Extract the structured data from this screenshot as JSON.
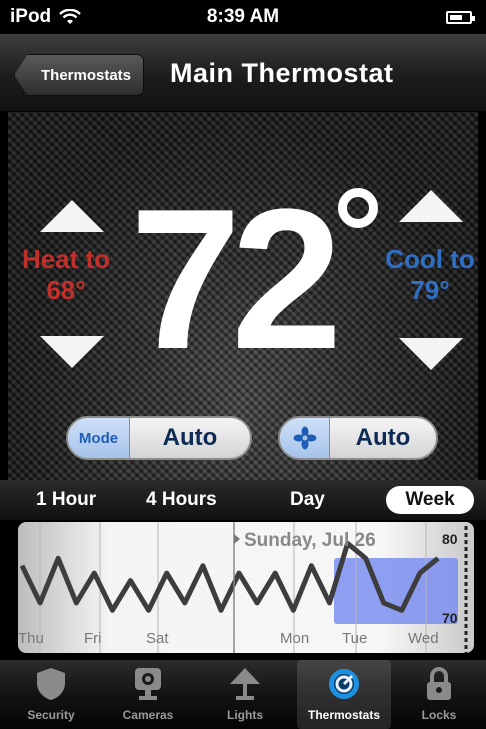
{
  "status_bar": {
    "carrier": "iPod",
    "time": "8:39 AM"
  },
  "nav": {
    "back_label": "Thermostats",
    "title": "Main Thermostat"
  },
  "thermostat": {
    "current_temp": "72",
    "heat_label": "Heat to",
    "heat_setpoint": "68°",
    "cool_label": "Cool to",
    "cool_setpoint": "79°",
    "mode_label": "Mode",
    "mode_value": "Auto",
    "fan_value": "Auto"
  },
  "range_tabs": {
    "one_hour": "1 Hour",
    "four_hours": "4 Hours",
    "day": "Day",
    "week": "Week",
    "selected": "Week"
  },
  "chart_data": {
    "type": "line",
    "title": "Sunday, Jul 26",
    "x_tick_labels": [
      "Thu",
      "Fri",
      "Sat",
      "Mon",
      "Tue",
      "Wed"
    ],
    "y_tick_labels": [
      "80",
      "70"
    ],
    "ylim": [
      67,
      81
    ],
    "series": [
      {
        "values": [
          77,
          72,
          78,
          72,
          76,
          71,
          75,
          71,
          76,
          72,
          77,
          71,
          76,
          72,
          76,
          71,
          77,
          72,
          80,
          78,
          72,
          71,
          76,
          78
        ]
      }
    ]
  },
  "tabbar": {
    "items": [
      {
        "label": "Security",
        "icon": "shield-icon"
      },
      {
        "label": "Cameras",
        "icon": "camera-icon"
      },
      {
        "label": "Lights",
        "icon": "lamp-icon"
      },
      {
        "label": "Thermostats",
        "icon": "thermostat-dial-icon"
      },
      {
        "label": "Locks",
        "icon": "lock-icon"
      }
    ],
    "selected": "Thermostats"
  },
  "colors": {
    "heat": "#c1302a",
    "cool": "#2f6fc4",
    "chart_highlight": "#7b8ef0"
  }
}
